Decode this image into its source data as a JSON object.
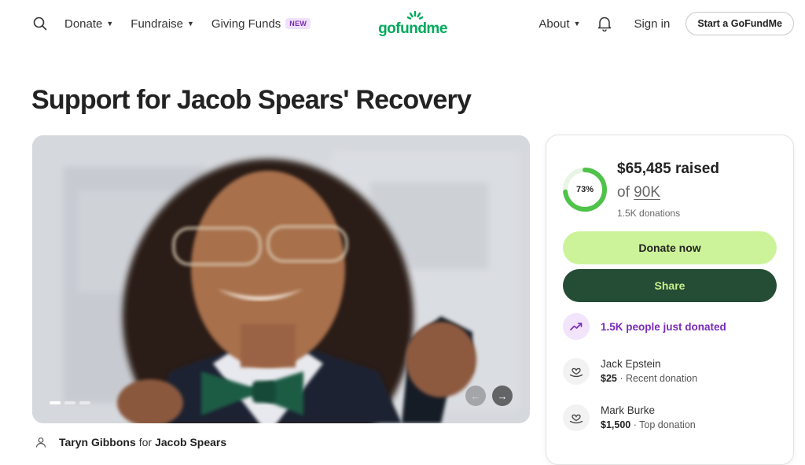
{
  "nav": {
    "donate": "Donate",
    "fundraise": "Fundraise",
    "giving_funds": "Giving Funds",
    "new_badge": "NEW",
    "logo": "gofundme",
    "about": "About",
    "sign_in": "Sign in",
    "start": "Start a GoFundMe"
  },
  "page_title": "Support for Jacob Spears' Recovery",
  "organizer": {
    "name": "Taryn Gibbons",
    "for_word": "for",
    "beneficiary": "Jacob Spears"
  },
  "campaign": {
    "progress_percent": 73,
    "progress_label": "73%",
    "raised": "$65,485 raised",
    "goal_prefix": "of",
    "goal": "90K",
    "donations_count": "1.5K donations",
    "donate_label": "Donate now",
    "share_label": "Share",
    "trend_text": "1.5K people just donated"
  },
  "donors": [
    {
      "name": "Jack Epstein",
      "amount": "$25",
      "note": "· Recent donation"
    },
    {
      "name": "Mark Burke",
      "amount": "$1,500",
      "note": "· Top donation"
    }
  ],
  "colors": {
    "brand_green": "#02a95c",
    "donate_bg": "#cdf39a",
    "share_bg": "#254c35",
    "trend_purple": "#7a2bb8"
  },
  "icons": {
    "search": "search-icon",
    "bell": "bell-icon",
    "trend": "trending-up-icon",
    "donor": "heart-hand-icon",
    "avatar": "user-icon"
  }
}
